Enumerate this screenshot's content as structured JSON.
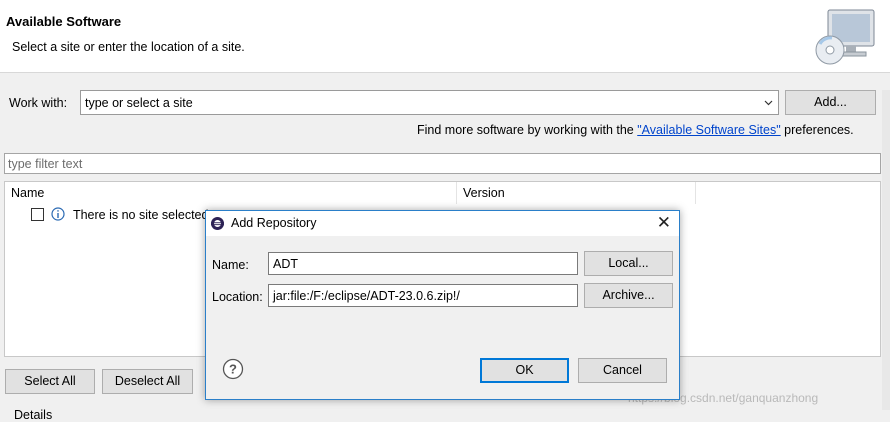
{
  "header": {
    "title": "Available Software",
    "subtitle": "Select a site or enter the location of a site."
  },
  "work_with": {
    "label": "Work with:",
    "value": "type or select a site",
    "add_button": "Add..."
  },
  "find_more": {
    "prefix": "Find more software by working with the ",
    "link": "\"Available Software Sites\"",
    "suffix": " preferences."
  },
  "filter": {
    "placeholder": "type filter text"
  },
  "tree": {
    "columns": [
      "Name",
      "Version"
    ],
    "message": "There is no site selected."
  },
  "buttons": {
    "select_all": "Select All",
    "deselect_all": "Deselect All"
  },
  "details_label": "Details",
  "watermark": "https://blog.csdn.net/ganquanzhong",
  "dialog": {
    "title": "Add Repository",
    "name_label": "Name:",
    "name_value": "ADT",
    "location_label": "Location:",
    "location_value": "jar:file:/F:/eclipse/ADT-23.0.6.zip!/",
    "local_button": "Local...",
    "archive_button": "Archive...",
    "ok_button": "OK",
    "cancel_button": "Cancel"
  }
}
